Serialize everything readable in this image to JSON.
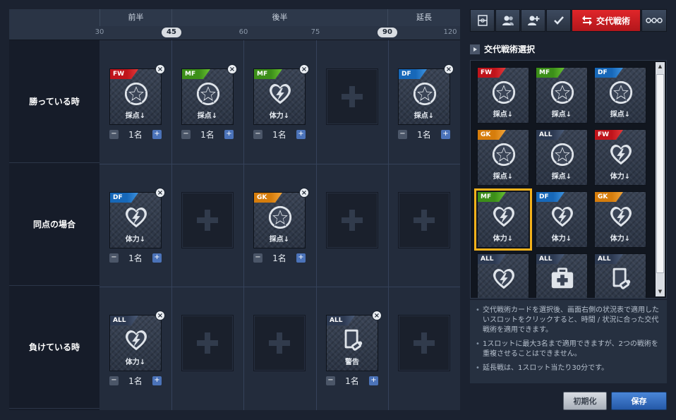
{
  "timeline": {
    "phases": [
      {
        "label": "前半"
      },
      {
        "label": "後半"
      },
      {
        "label": "延長"
      }
    ],
    "ticks": [
      "30",
      "45",
      "60",
      "75",
      "90",
      "120"
    ],
    "highlighted_ticks": [
      "45",
      "90"
    ]
  },
  "rows": [
    {
      "label": "勝っている時"
    },
    {
      "label": "同点の場合"
    },
    {
      "label": "負けている時"
    }
  ],
  "slots": [
    {
      "row": 0,
      "col": 0,
      "filled": true,
      "position": "FW",
      "icon": "star-icon",
      "label": "採点↓",
      "count": "1名"
    },
    {
      "row": 0,
      "col": 1,
      "filled": true,
      "position": "MF",
      "icon": "star-icon",
      "label": "採点↓",
      "count": "1名"
    },
    {
      "row": 0,
      "col": 2,
      "filled": true,
      "position": "MF",
      "icon": "heart-icon",
      "label": "体力↓",
      "count": "1名"
    },
    {
      "row": 0,
      "col": 3,
      "filled": false
    },
    {
      "row": 0,
      "col": 4,
      "filled": true,
      "position": "DF",
      "icon": "star-icon",
      "label": "採点↓",
      "count": "1名"
    },
    {
      "row": 1,
      "col": 0,
      "filled": true,
      "position": "DF",
      "icon": "heart-icon",
      "label": "体力↓",
      "count": "1名"
    },
    {
      "row": 1,
      "col": 1,
      "filled": false
    },
    {
      "row": 1,
      "col": 2,
      "filled": true,
      "position": "GK",
      "icon": "star-icon",
      "label": "採点↓",
      "count": "1名"
    },
    {
      "row": 1,
      "col": 3,
      "filled": false
    },
    {
      "row": 1,
      "col": 4,
      "filled": false
    },
    {
      "row": 2,
      "col": 0,
      "filled": true,
      "position": "ALL",
      "icon": "heart-icon",
      "label": "体力↓",
      "count": "1名"
    },
    {
      "row": 2,
      "col": 1,
      "filled": false
    },
    {
      "row": 2,
      "col": 2,
      "filled": false
    },
    {
      "row": 2,
      "col": 3,
      "filled": true,
      "position": "ALL",
      "icon": "card-icon",
      "label": "警告",
      "count": "1名"
    },
    {
      "row": 2,
      "col": 4,
      "filled": false
    }
  ],
  "tabs": [
    {
      "name": "formation-tab",
      "icon": "formation-icon"
    },
    {
      "name": "players-tab",
      "icon": "players-icon"
    },
    {
      "name": "add-player-tab",
      "icon": "add-player-icon"
    },
    {
      "name": "check-tab",
      "icon": "check-icon"
    },
    {
      "name": "substitution-tab",
      "icon": "swap-icon",
      "label": "交代戦術",
      "active": true
    },
    {
      "name": "link-tab",
      "icon": "link-icon"
    }
  ],
  "selection": {
    "title": "交代戦術選択",
    "cards": [
      {
        "position": "FW",
        "icon": "star-icon",
        "label": "採点↓"
      },
      {
        "position": "MF",
        "icon": "star-icon",
        "label": "採点↓"
      },
      {
        "position": "DF",
        "icon": "star-icon",
        "label": "採点↓"
      },
      {
        "position": "GK",
        "icon": "star-icon",
        "label": "採点↓"
      },
      {
        "position": "ALL",
        "icon": "star-icon",
        "label": "採点↓"
      },
      {
        "position": "FW",
        "icon": "heart-icon",
        "label": "体力↓"
      },
      {
        "position": "MF",
        "icon": "heart-icon",
        "label": "体力↓",
        "selected": true
      },
      {
        "position": "DF",
        "icon": "heart-icon",
        "label": "体力↓"
      },
      {
        "position": "GK",
        "icon": "heart-icon",
        "label": "体力↓"
      },
      {
        "position": "ALL",
        "icon": "heart-icon",
        "label": ""
      },
      {
        "position": "ALL",
        "icon": "medkit-icon",
        "label": ""
      },
      {
        "position": "ALL",
        "icon": "card-icon",
        "label": ""
      }
    ]
  },
  "notes": [
    "交代戦術カードを選択後、画面右側の状況表で適用したいスロットをクリックすると、時間 / 状況に合った交代戦術を適用できます。",
    "1スロットに最大3名まで適用できますが、2つの戦術を重複させることはできません。",
    "延長戦は、1スロット当たり30分です。"
  ],
  "buttons": {
    "reset": "初期化",
    "save": "保存"
  },
  "colors": {
    "active_tab": "#c81e22",
    "save": "#2e66b6",
    "selection_highlight": "#f5b21b"
  }
}
